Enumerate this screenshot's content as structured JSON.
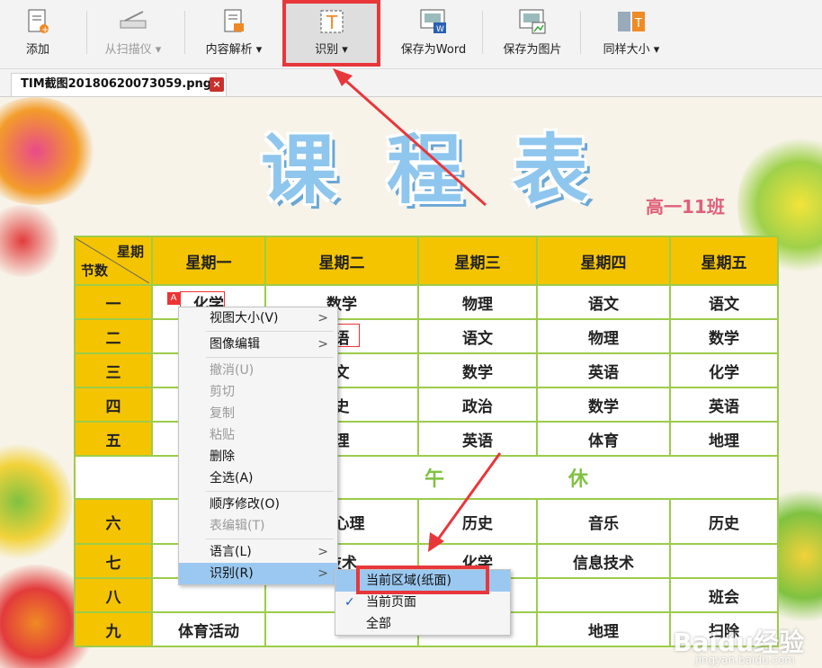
{
  "toolbar": {
    "add": "添加",
    "scan": "从扫描仪",
    "parse": "内容解析",
    "ocr": "识别",
    "save_word": "保存为Word",
    "save_image": "保存为图片",
    "same_size": "同样大小"
  },
  "tab": {
    "title": "TIM截图20180620073059.png",
    "close": "×"
  },
  "schedule": {
    "title_chars": [
      "课",
      "程",
      "表"
    ],
    "class_label": "高一11班",
    "corner_top": "星期",
    "corner_bottom": "节数",
    "days": [
      "星期一",
      "星期二",
      "星期三",
      "星期四",
      "星期五"
    ],
    "rows": [
      {
        "period": "一",
        "cells": [
          "化学",
          "数学",
          "物理",
          "语文",
          "语文"
        ]
      },
      {
        "period": "二",
        "cells": [
          "",
          "语",
          "语文",
          "物理",
          "数学"
        ]
      },
      {
        "period": "三",
        "cells": [
          "",
          "文",
          "数学",
          "英语",
          "化学"
        ]
      },
      {
        "period": "四",
        "cells": [
          "",
          "史",
          "政治",
          "数学",
          "英语"
        ]
      },
      {
        "period": "五",
        "cells": [
          "",
          "理",
          "英语",
          "体育",
          "地理"
        ]
      }
    ],
    "break_label_a": "午",
    "break_label_b": "休",
    "rows2": [
      {
        "period": "六",
        "cells": [
          "",
          "双心理",
          "历史",
          "音乐",
          "历史"
        ]
      },
      {
        "period": "七",
        "cells": [
          "",
          "技术",
          "化学",
          "信息技术",
          ""
        ]
      },
      {
        "period": "八",
        "cells": [
          "",
          "",
          "",
          "",
          "班会"
        ]
      },
      {
        "period": "九",
        "cells": [
          "体育活动",
          "",
          "",
          "地理",
          "扫除"
        ]
      }
    ]
  },
  "context_menu": {
    "items": [
      {
        "label": "视图大小(V)",
        "sub": ">"
      },
      {
        "label": "图像编辑",
        "sub": ">"
      },
      {
        "label": "撤消(U)"
      },
      {
        "label": "剪切"
      },
      {
        "label": "复制"
      },
      {
        "label": "粘贴"
      },
      {
        "label": "删除"
      },
      {
        "label": "全选(A)"
      },
      {
        "label": "顺序修改(O)"
      },
      {
        "label": "表编辑(T)"
      },
      {
        "label": "语言(L)",
        "sub": ">"
      },
      {
        "label": "识别(R)",
        "sub": ">"
      }
    ]
  },
  "submenu": {
    "items": [
      {
        "label": "当前区域(纸面)"
      },
      {
        "label": "当前页面",
        "check": "✓"
      },
      {
        "label": "全部"
      }
    ]
  },
  "watermark": {
    "main": "Baidu经验",
    "sub": "jingyan.baidu.com"
  },
  "colors": {
    "highlight": "#e8373b",
    "header_yellow": "#f5c400",
    "grid_green": "#9ccc4a",
    "menu_active": "#9bc8f0"
  }
}
